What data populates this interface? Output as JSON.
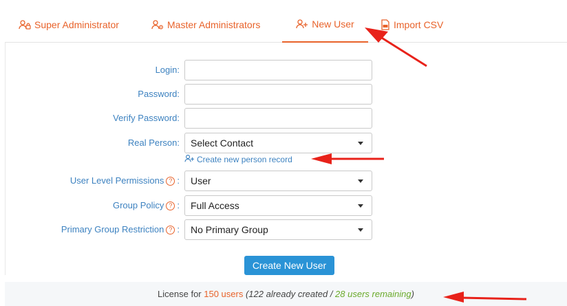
{
  "tabs": [
    {
      "label": "Super Administrator",
      "icon": "users-lock-icon"
    },
    {
      "label": "Master Administrators",
      "icon": "users-gear-icon"
    },
    {
      "label": "New User",
      "icon": "user-plus-icon",
      "active": true
    },
    {
      "label": "Import CSV",
      "icon": "csv-file-icon"
    }
  ],
  "form": {
    "login_label": "Login:",
    "password_label": "Password:",
    "verify_password_label": "Verify Password:",
    "real_person_label": "Real Person:",
    "real_person_value": "Select Contact",
    "create_person_link": "Create new person record",
    "user_level_label": "User Level Permissions",
    "user_level_value": "User",
    "group_policy_label": "Group Policy",
    "group_policy_value": "Full Access",
    "primary_group_label": "Primary Group Restriction",
    "primary_group_value": "No Primary Group",
    "help_symbol": "?",
    "colon": ":",
    "submit_label": "Create New User"
  },
  "license": {
    "prefix": "License for ",
    "total": "150 users",
    "open": " (",
    "created": "122 already created",
    "sep": " / ",
    "remaining": "28 users remaining",
    "close": ")"
  },
  "colors": {
    "accent": "#e8622a",
    "label_blue": "#3d82c0",
    "button_blue": "#2a93d6",
    "green": "#6aaa2a",
    "annotation_red": "#e8221a"
  }
}
